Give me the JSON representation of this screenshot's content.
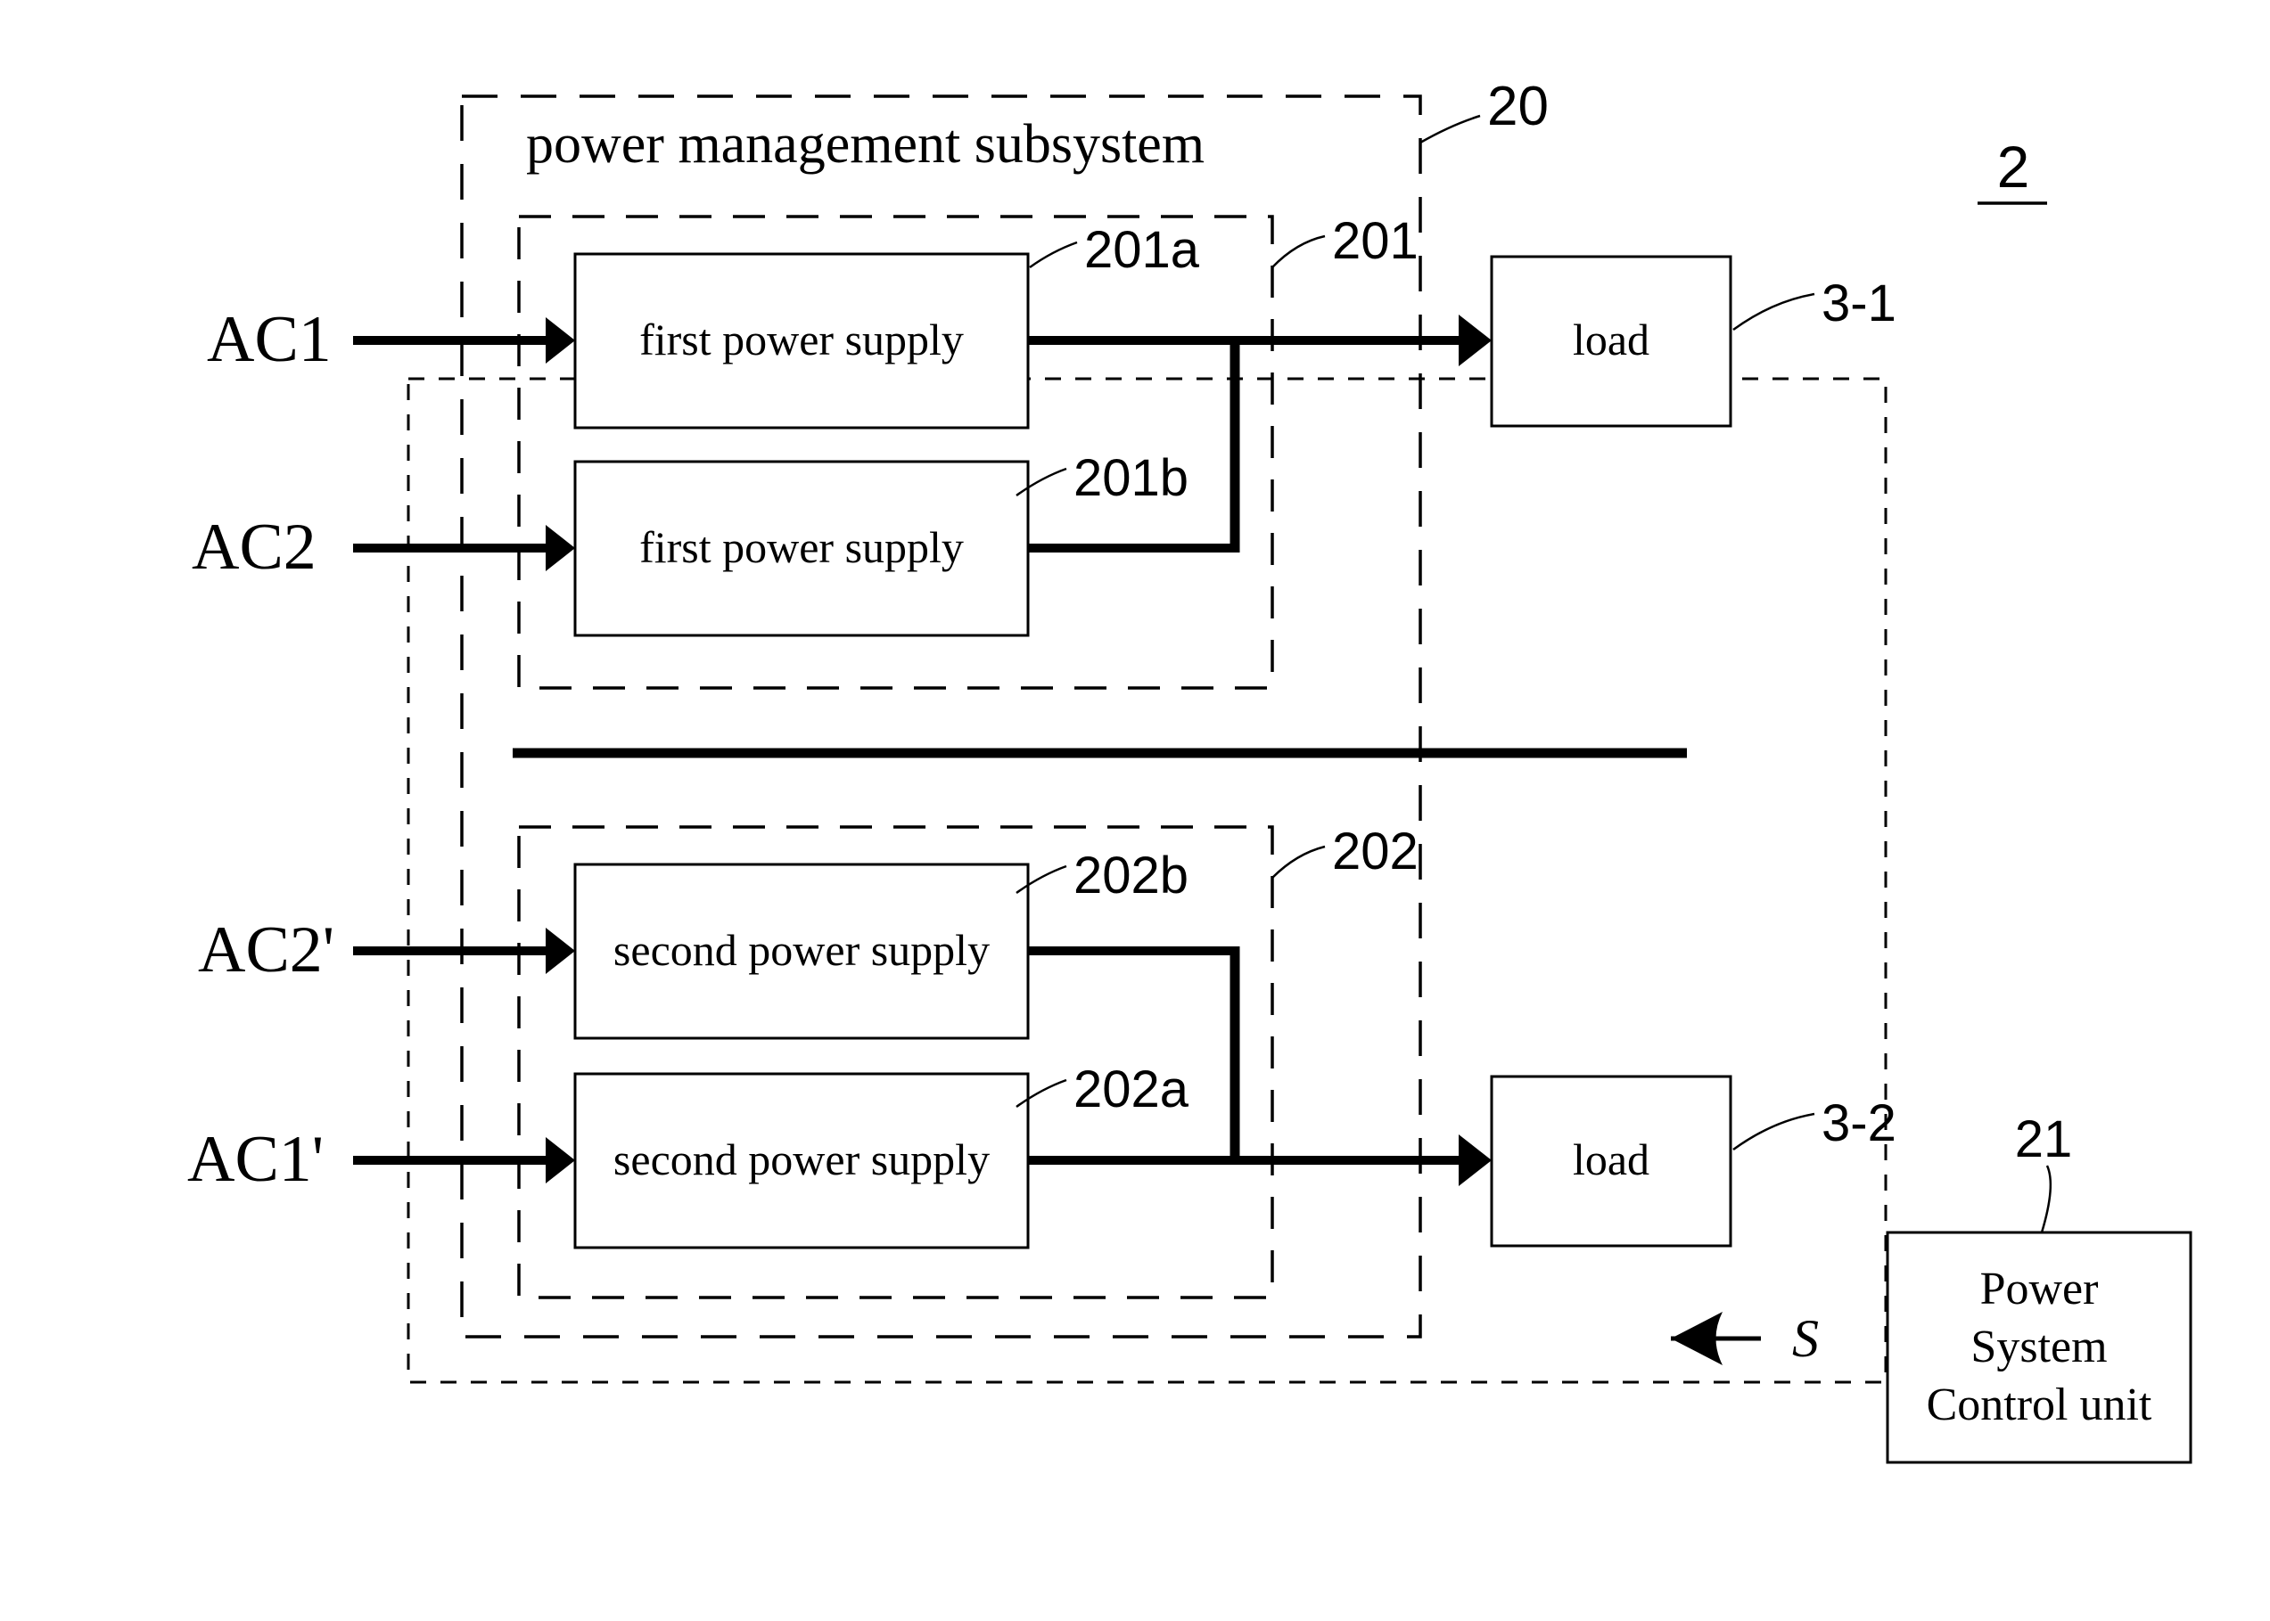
{
  "figure": {
    "number": "2",
    "type": "patent-block-diagram"
  },
  "colors": {
    "stroke": "#000000",
    "background": "#ffffff"
  },
  "subsystem": {
    "title": "power management subsystem",
    "ref": "20"
  },
  "groups": [
    {
      "ref": "201"
    },
    {
      "ref": "202"
    }
  ],
  "inputs": [
    {
      "label": "AC1"
    },
    {
      "label": "AC2"
    },
    {
      "label": "AC2'"
    },
    {
      "label": "AC1'"
    }
  ],
  "blocks": {
    "first_supply_a": {
      "label": "first power supply",
      "ref": "201a"
    },
    "first_supply_b": {
      "label": "first power supply",
      "ref": "201b"
    },
    "second_supply_b": {
      "label": "second power supply",
      "ref": "202b"
    },
    "second_supply_a": {
      "label": "second power supply",
      "ref": "202a"
    },
    "load_top": {
      "label": "load",
      "ref": "3-1"
    },
    "load_bottom": {
      "label": "load",
      "ref": "3-2"
    },
    "control_unit": {
      "label_line1": "Power",
      "label_line2": "System",
      "label_line3": "Control unit",
      "ref": "21"
    }
  },
  "signals": [
    {
      "label": "S",
      "direction": "left"
    }
  ]
}
